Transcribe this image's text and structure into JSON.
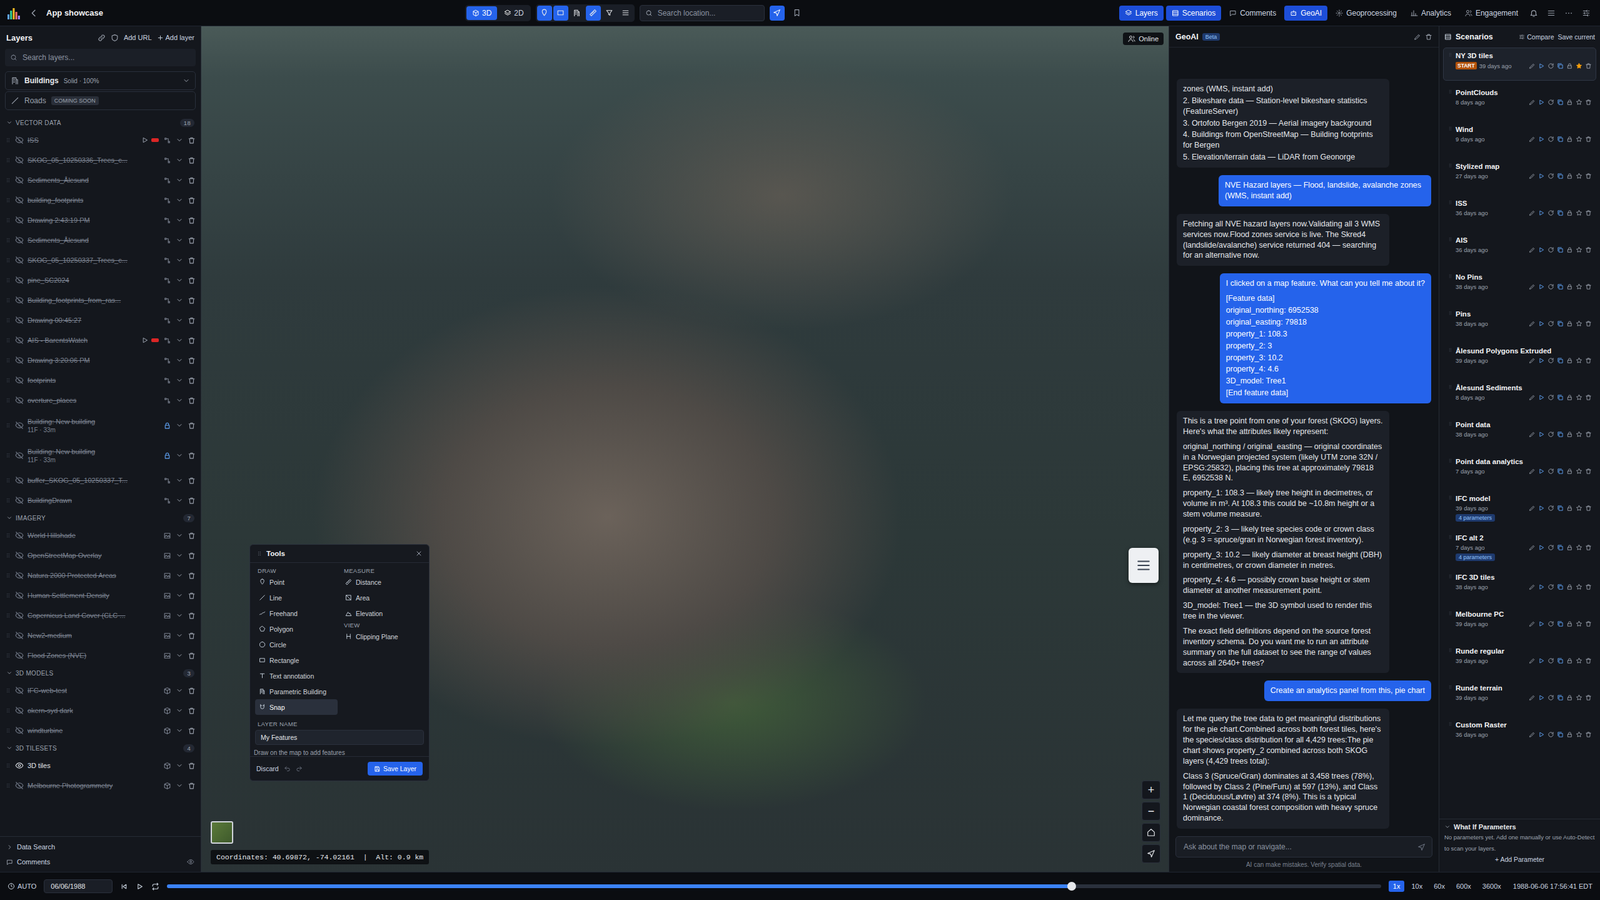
{
  "app": {
    "title": "App showcase"
  },
  "view_modes": [
    {
      "label": "3D",
      "selected": true
    },
    {
      "label": "2D",
      "selected": false
    }
  ],
  "location_search": {
    "placeholder": "Search location..."
  },
  "nav": [
    {
      "label": "Layers",
      "selected": true
    },
    {
      "label": "Scenarios",
      "selected": true
    },
    {
      "label": "Comments",
      "selected": false
    },
    {
      "label": "GeoAI",
      "selected": true
    },
    {
      "label": "Geoprocessing",
      "selected": false
    },
    {
      "label": "Analytics",
      "selected": false
    },
    {
      "label": "Engagement",
      "selected": false
    }
  ],
  "layers_panel": {
    "title": "Layers",
    "add_url": "Add URL",
    "add_layer": "Add layer",
    "search": {
      "placeholder": "Search layers..."
    },
    "base": [
      {
        "name": "Buildings",
        "badge": "Solid · 100%",
        "disabled": false
      },
      {
        "name": "Roads",
        "badge": "COMING SOON",
        "disabled": true
      }
    ],
    "groups": [
      {
        "title": "VECTOR DATA",
        "count": "18",
        "expanded": true,
        "items": [
          {
            "name": "ISS",
            "visible": false,
            "live": true
          },
          {
            "name": "SKOG_05_10250336_Trees_c...",
            "visible": false,
            "live": false
          },
          {
            "name": "Sediments_Ålesund",
            "visible": false,
            "live": false
          },
          {
            "name": "building_footprints",
            "visible": false,
            "live": false
          },
          {
            "name": "Drawing 2:43:19 PM",
            "visible": false,
            "live": false
          },
          {
            "name": "Sediments_Ålesund",
            "visible": false,
            "live": false
          },
          {
            "name": "SKOG_05_10250337_Trees_c...",
            "visible": false,
            "live": false
          },
          {
            "name": "pine_SC2024",
            "visible": false,
            "live": false
          },
          {
            "name": "Building_footprints_from_ras...",
            "visible": false,
            "live": false
          },
          {
            "name": "Drawing 00:45:27",
            "visible": false,
            "live": false
          },
          {
            "name": "AIS - BarentsWatch",
            "visible": false,
            "live": true
          },
          {
            "name": "Drawing 3:20:06 PM",
            "visible": false,
            "live": false
          },
          {
            "name": "footprints",
            "visible": false,
            "live": false
          },
          {
            "name": "overture_places",
            "visible": false,
            "live": false
          },
          {
            "name": "Building: New building",
            "subtitle": "11F · 33m",
            "visible": false,
            "live": false
          },
          {
            "name": "Building: New building",
            "subtitle": "11F · 33m",
            "visible": false,
            "live": false
          },
          {
            "name": "buffer_SKOG_05_10250337_T...",
            "visible": false,
            "live": false
          },
          {
            "name": "BuildingDrawn",
            "visible": false,
            "live": false
          }
        ]
      },
      {
        "title": "IMAGERY",
        "count": "7",
        "expanded": true,
        "items": [
          {
            "name": "World Hillshade",
            "visible": false,
            "live": false
          },
          {
            "name": "OpenStreetMap Overlay",
            "visible": false,
            "live": false
          },
          {
            "name": "Natura 2000 Protected Areas",
            "visible": false,
            "live": false
          },
          {
            "name": "Human Settlement Density",
            "visible": false,
            "live": false
          },
          {
            "name": "Copernicus Land Cover (CLC ...",
            "visible": false,
            "live": false
          },
          {
            "name": "New2-medium",
            "visible": false,
            "live": false
          },
          {
            "name": "Flood Zones (NVE)",
            "visible": false,
            "live": false
          }
        ]
      },
      {
        "title": "3D MODELS",
        "count": "3",
        "expanded": true,
        "items": [
          {
            "name": "IFC-web-test",
            "visible": false,
            "live": false
          },
          {
            "name": "okern-syd dark",
            "visible": false,
            "live": false
          },
          {
            "name": "windturbine",
            "visible": false,
            "live": false
          }
        ]
      },
      {
        "title": "3D TILESETS",
        "count": "4",
        "expanded": true,
        "items": [
          {
            "name": "3D tiles",
            "visible": true,
            "live": false
          },
          {
            "name": "Melbourne Photogrammetry",
            "visible": false,
            "live": false
          }
        ]
      }
    ],
    "footer": [
      {
        "label": "Data Search",
        "expanded": false
      },
      {
        "label": "Comments",
        "expanded": false
      }
    ]
  },
  "map": {
    "status": "Online",
    "coordinates": "Coordinates: 40.69872, -74.02161  |  Alt: 0.9 km",
    "zoom_in": "+",
    "zoom_out": "−"
  },
  "tools": {
    "title": "Tools",
    "draw_title": "DRAW",
    "draw": [
      {
        "label": "Point",
        "selected": false
      },
      {
        "label": "Line",
        "selected": false
      },
      {
        "label": "Freehand",
        "selected": false
      },
      {
        "label": "Polygon",
        "selected": false
      },
      {
        "label": "Circle",
        "selected": false
      },
      {
        "label": "Rectangle",
        "selected": false
      },
      {
        "label": "Text annotation",
        "selected": false
      },
      {
        "label": "Parametric Building",
        "selected": false
      },
      {
        "label": "Snap",
        "selected": true
      }
    ],
    "measure_title": "MEASURE",
    "measure": [
      {
        "label": "Distance",
        "selected": false
      },
      {
        "label": "Area",
        "selected": false
      },
      {
        "label": "Elevation",
        "selected": false
      }
    ],
    "view_title": "VIEW",
    "view": [
      {
        "label": "Clipping Plane",
        "selected": false
      }
    ],
    "layer_name_label": "LAYER NAME",
    "layer_name": "My Features",
    "hint": "Draw on the map to add features",
    "discard": "Discard",
    "save": "Save Layer"
  },
  "chat": {
    "title": "GeoAI",
    "badge": "Beta",
    "messages": [
      {
        "kind": "assistant",
        "paragraphs": [
          [
            "zones (WMS, instant add)",
            "2. Bikeshare data — Station-level bikeshare statistics (FeatureServer)",
            "3. Ortofoto Bergen 2019 — Aerial imagery background",
            "4. Buildings from OpenStreetMap — Building footprints for Bergen",
            "5. Elevation/terrain data — LiDAR from Geonorge"
          ]
        ]
      },
      {
        "kind": "user",
        "paragraphs": [
          "NVE Hazard layers — Flood, landslide, avalanche zones (WMS, instant add)"
        ]
      },
      {
        "kind": "assistant",
        "paragraphs": [
          "Fetching all NVE hazard layers now.Validating all 3 WMS services now.Flood zones service is live. The Skred4 (landslide/avalanche) service returned 404 — searching for an alternative now."
        ]
      },
      {
        "kind": "user",
        "paragraphs": [
          "I clicked on a map feature. What can you tell me about it?",
          [
            "[Feature data]",
            "original_northing: 6952538",
            "original_easting: 79818",
            "property_1: 108.3",
            "property_2: 3",
            "property_3: 10.2",
            "property_4: 4.6",
            "3D_model: Tree1",
            "[End feature data]"
          ]
        ]
      },
      {
        "kind": "assistant",
        "paragraphs": [
          "This is a tree point from one of your forest (SKOG) layers. Here's what the attributes likely represent:",
          "original_northing / original_easting — original coordinates in a Norwegian projected system (likely UTM zone 32N / EPSG:25832), placing this tree at approximately 79818 E, 6952538 N.",
          "property_1: 108.3 — likely tree height in decimetres, or volume in m³. At 108.3 this could be ~10.8m height or a stem volume measure.",
          "property_2: 3 — likely tree species code or crown class (e.g. 3 = spruce/gran in Norwegian forest inventory).",
          "property_3: 10.2 — likely diameter at breast height (DBH) in centimetres, or crown diameter in metres.",
          "property_4: 4.6 — possibly crown base height or stem diameter at another measurement point.",
          "3D_model: Tree1 — the 3D symbol used to render this tree in the viewer.",
          "The exact field definitions depend on the source forest inventory schema. Do you want me to run an attribute summary on the full dataset to see the range of values across all 2640+ trees?"
        ]
      },
      {
        "kind": "user",
        "paragraphs": [
          "Create an analytics panel from this, pie chart"
        ]
      },
      {
        "kind": "assistant",
        "paragraphs": [
          "Let me query the tree data to get meaningful distributions for the pie chart.Combined across both forest tiles, here's the species/class distribution for all 4,429 trees:The pie chart shows property_2 combined across both SKOG layers (4,429 trees total):",
          "Class 3 (Spruce/Gran) dominates at 3,458 trees (78%), followed by Class 2 (Pine/Furu) at 597 (13%), and Class 1 (Deciduous/Løvtre) at 374 (8%). This is a typical Norwegian coastal forest composition with heavy spruce dominance."
        ]
      }
    ],
    "input": {
      "placeholder": "Ask about the map or navigate..."
    },
    "note": "AI can make mistakes. Verify spatial data."
  },
  "scenarios": {
    "title": "Scenarios",
    "compare": "Compare",
    "save": "Save current",
    "items": [
      {
        "name": "NY 3D tiles",
        "age": "39 days ago",
        "start": "START",
        "selected": true,
        "starred": true
      },
      {
        "name": "PointClouds",
        "age": "8 days ago",
        "selected": false,
        "starred": false
      },
      {
        "name": "Wind",
        "age": "9 days ago",
        "selected": false,
        "starred": false
      },
      {
        "name": "Stylized map",
        "age": "27 days ago",
        "selected": false,
        "starred": false
      },
      {
        "name": "ISS",
        "age": "36 days ago",
        "selected": false,
        "starred": false
      },
      {
        "name": "AIS",
        "age": "36 days ago",
        "selected": false,
        "starred": false
      },
      {
        "name": "No Pins",
        "age": "38 days ago",
        "selected": false,
        "starred": false
      },
      {
        "name": "Pins",
        "age": "38 days ago",
        "selected": false,
        "starred": false
      },
      {
        "name": "Ålesund Polygons Extruded",
        "age": "39 days ago",
        "selected": false,
        "starred": false
      },
      {
        "name": "Ålesund Sediments",
        "age": "8 days ago",
        "selected": false,
        "starred": false
      },
      {
        "name": "Point data",
        "age": "38 days ago",
        "selected": false,
        "starred": false
      },
      {
        "name": "Point data analytics",
        "age": "7 days ago",
        "selected": false,
        "starred": false
      },
      {
        "name": "IFC model",
        "age": "39 days ago",
        "badge": "4 parameters",
        "selected": false,
        "starred": false
      },
      {
        "name": "IFC alt 2",
        "age": "7 days ago",
        "badge": "4 parameters",
        "selected": false,
        "starred": false
      },
      {
        "name": "IFC 3D tiles",
        "age": "38 days ago",
        "selected": false,
        "starred": false
      },
      {
        "name": "Melbourne PC",
        "age": "39 days ago",
        "selected": false,
        "starred": false
      },
      {
        "name": "Runde regular",
        "age": "39 days ago",
        "selected": false,
        "starred": false
      },
      {
        "name": "Runde terrain",
        "age": "39 days ago",
        "selected": false,
        "starred": false
      },
      {
        "name": "Custom Raster",
        "age": "36 days ago",
        "selected": false,
        "starred": false
      }
    ],
    "what_if": {
      "title": "What If Parameters",
      "expanded": true,
      "text": "No parameters yet. Add one manually or use Auto-Detect to scan your layers.",
      "add": "+ Add Parameter"
    }
  },
  "timeline": {
    "mode": "AUTO",
    "date": "06/06/1988",
    "level": 0.745,
    "speeds": [
      {
        "label": "1x",
        "selected": true
      },
      {
        "label": "10x",
        "selected": false
      },
      {
        "label": "60x",
        "selected": false
      },
      {
        "label": "600x",
        "selected": false
      },
      {
        "label": "3600x",
        "selected": false
      }
    ],
    "timestamp": "1988-06-06 17:56:41 EDT"
  }
}
